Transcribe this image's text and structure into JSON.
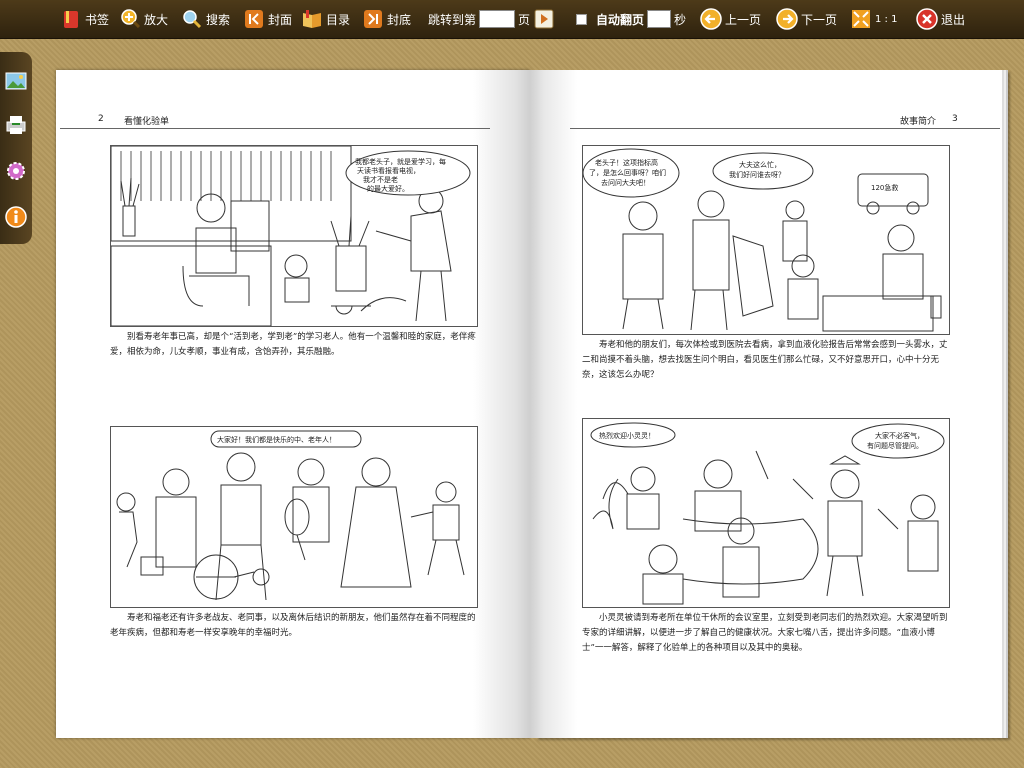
{
  "toolbar": {
    "bookmark": "书签",
    "zoom": "放大",
    "search": "搜索",
    "cover": "封面",
    "toc": "目录",
    "back_cover": "封底",
    "jump_to": "跳转到第",
    "page_unit": "页",
    "auto_flip": "自动翻页",
    "seconds_unit": "秒",
    "prev": "上一页",
    "next": "下一页",
    "ratio": "1 : 1",
    "exit": "退出"
  },
  "left_page": {
    "number": "2",
    "header": "看懂化验单",
    "captions": [
      "别看寿老年事已高，却是个“活到老，学到老”的学习老人。他有一个温馨和睦的家庭，老伴疼爱，相依为命，儿女孝顺，事业有成，含饴弄孙，其乐融融。",
      "寿老和福老还有许多老战友、老同事，以及离休后结识的新朋友，他们虽然存在着不同程度的老年疾病，但都和寿老一样安享晚年的幸福时光。"
    ],
    "bubbles": {
      "panel1": [
        "我都老头子，就是爱学习，每",
        "天读书看报看电视，",
        "我才不是老",
        "的最大爱好。"
      ],
      "panel2": [
        "大家好！我们都是快乐的中、老年人！"
      ]
    }
  },
  "right_page": {
    "number": "3",
    "header": "故事简介",
    "captions": [
      "寿老和他的朋友们，每次体检或到医院去看病，拿到血液化验报告后常常会感到一头雾水，丈二和尚摸不着头脑，想去找医生问个明白，看见医生们那么忙碌，又不好意思开口，心中十分无奈，这该怎么办呢？",
      "小灵灵被请到寿老所在单位干休所的会议室里，立刻受到老同志们的热烈欢迎。大家渴望听到专家的详细讲解，以便进一步了解自己的健康状况。大家七嘴八舌，提出许多问题。“血液小博士”一一解答，解释了化验单上的各种项目以及其中的奥秘。"
    ],
    "bubbles": {
      "panel1a": [
        "老头子！这项指标高",
        "了，是怎么回事呀？咱们",
        "去问问大夫吧！"
      ],
      "panel1b": [
        "大夫这么忙，",
        "我们好问谁去呀？"
      ],
      "ambulance": "120急救",
      "panel2a": [
        "热烈欢迎小灵灵！"
      ],
      "panel2b": [
        "大家不必客气，",
        "有问题尽管提问。"
      ]
    }
  },
  "colors": {
    "toolbar_bg": "#3d2e14",
    "desk_bg": "#b59a5f",
    "exit_red": "#d8332a",
    "nav_orange": "#f0a020"
  }
}
